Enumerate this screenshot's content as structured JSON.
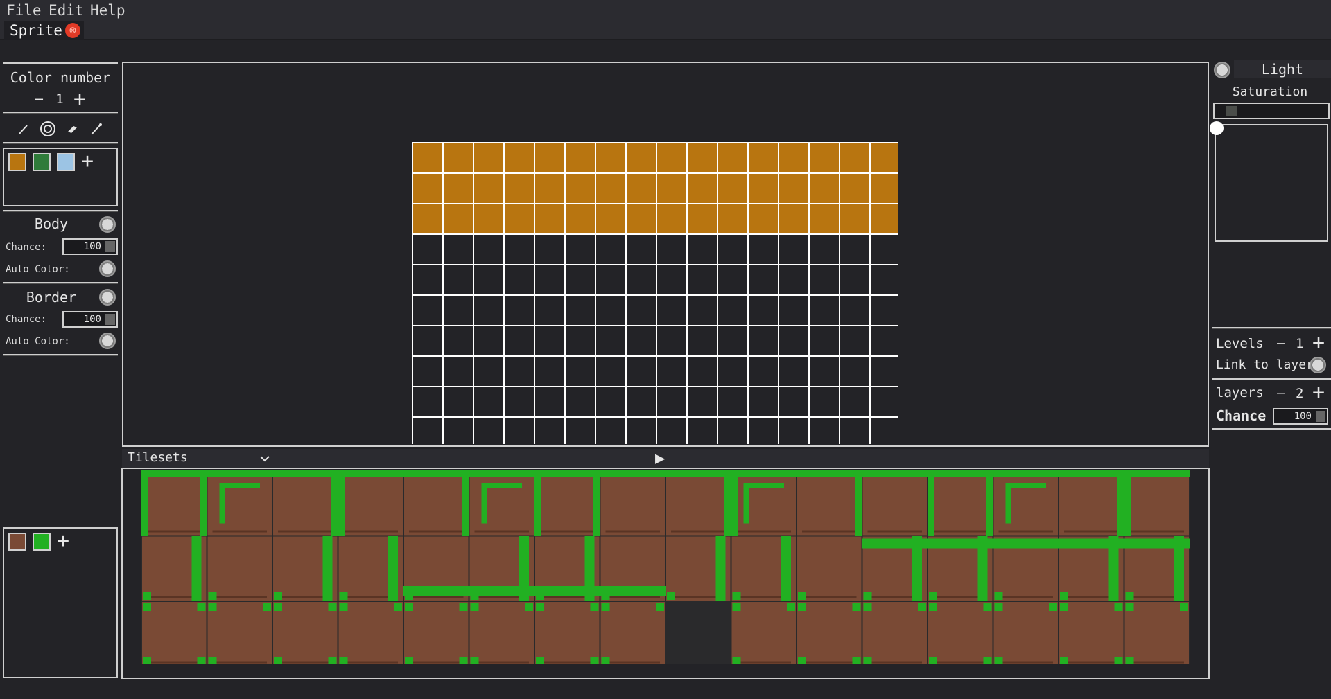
{
  "menu": {
    "file": "File",
    "edit": "Edit",
    "help": "Help"
  },
  "tab": {
    "label": "Sprite",
    "close": "⊗"
  },
  "left_panel": {
    "color_number_label": "Color number",
    "color_number_minus": "—",
    "color_number_value": "1",
    "color_number_plus": "+",
    "tools": [
      "pencil-icon",
      "fill-icon",
      "eraser-icon",
      "picker-icon"
    ],
    "palette": [
      "#b87510",
      "#2f7b3a",
      "#9cc4e4"
    ],
    "palette_add": "+",
    "body": {
      "title": "Body",
      "chance_label": "Chance:",
      "chance_value": "100",
      "auto_color_label": "Auto Color:"
    },
    "border": {
      "title": "Border",
      "chance_label": "Chance:",
      "chance_value": "100",
      "auto_color_label": "Auto Color:"
    },
    "tile_palette": [
      "#7a4a35",
      "#22b022"
    ],
    "tile_palette_add": "+"
  },
  "right_panel": {
    "light_label": "Light",
    "saturation_label": "Saturation",
    "levels_label": "Levels",
    "levels_minus": "—",
    "levels_value": "1",
    "levels_plus": "+",
    "link_label": "Link to layer",
    "layers_label": "layers",
    "layers_minus": "—",
    "layers_value": "2",
    "layers_plus": "+",
    "chance_label": "Chance",
    "chance_value": "100"
  },
  "tileset": {
    "dropdown_label": "Tilesets",
    "play": "▶"
  },
  "colors": {
    "fill": "#b87510",
    "tile_brown": "#7a4a35",
    "tile_green": "#22b022",
    "grid_line": "#ffffff"
  }
}
